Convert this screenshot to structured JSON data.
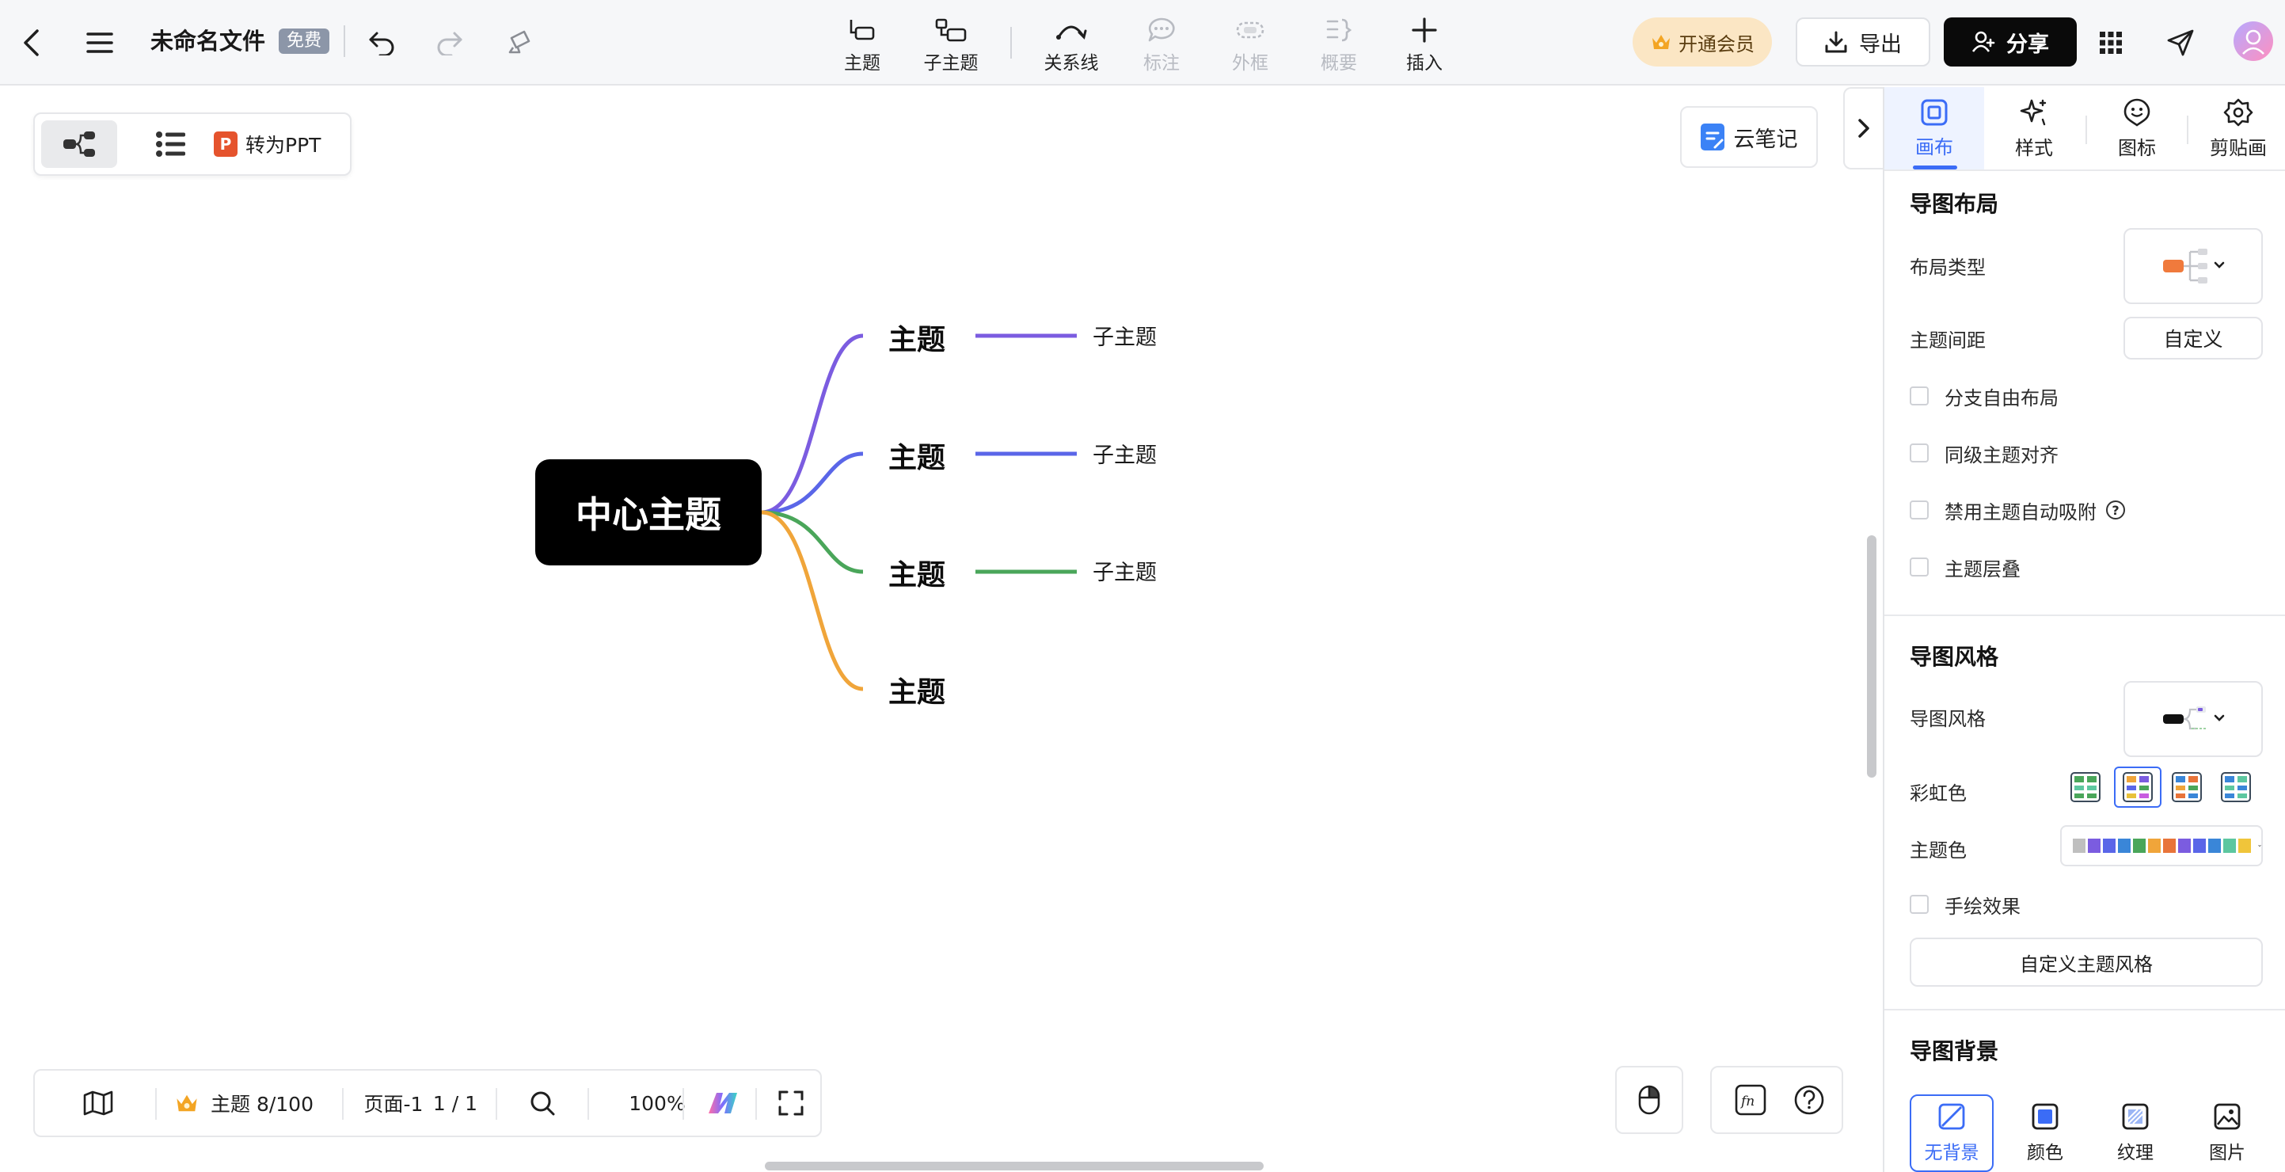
{
  "header": {
    "filename": "未命名文件",
    "badge": "免费",
    "tools": [
      {
        "label": "主题",
        "icon": "topic-icon",
        "enabled": true
      },
      {
        "label": "子主题",
        "icon": "subtopic-icon",
        "enabled": true
      },
      {
        "label": "关系线",
        "icon": "relation-line-icon",
        "enabled": true
      },
      {
        "label": "标注",
        "icon": "callout-icon",
        "enabled": false
      },
      {
        "label": "外框",
        "icon": "boundary-icon",
        "enabled": false
      },
      {
        "label": "概要",
        "icon": "summary-icon",
        "enabled": false
      },
      {
        "label": "插入",
        "icon": "plus-icon",
        "enabled": true
      }
    ],
    "vip_label": "开通会员",
    "export_label": "导出",
    "share_label": "分享"
  },
  "canvas": {
    "ppt_label": "转为PPT",
    "cloud_note_label": "云笔记",
    "center_topic": "中心主题",
    "topics": [
      {
        "label": "主题",
        "subtopic": "子主题",
        "color": "#7b5ce0"
      },
      {
        "label": "主题",
        "subtopic": "子主题",
        "color": "#5a66e8"
      },
      {
        "label": "主题",
        "subtopic": "子主题",
        "color": "#4aa65a"
      },
      {
        "label": "主题",
        "subtopic": "",
        "color": "#f0a53a"
      }
    ]
  },
  "bottom": {
    "topic_count": "主题 8/100",
    "page_label": "页面-1",
    "page_index": "1 / 1",
    "zoom": "100%"
  },
  "panel": {
    "tabs": [
      {
        "label": "画布",
        "icon": "canvas-icon",
        "active": true
      },
      {
        "label": "样式",
        "icon": "style-sparkle-icon",
        "active": false
      },
      {
        "label": "图标",
        "icon": "sticker-icon",
        "active": false
      },
      {
        "label": "剪贴画",
        "icon": "clipart-icon",
        "active": false
      }
    ],
    "layout": {
      "title": "导图布局",
      "layout_type_label": "布局类型",
      "spacing_label": "主题间距",
      "spacing_value": "自定义",
      "options": [
        "分支自由布局",
        "同级主题对齐",
        "禁用主题自动吸附",
        "主题层叠"
      ]
    },
    "style": {
      "title": "导图风格",
      "style_label": "导图风格",
      "rainbow_label": "彩虹色",
      "theme_color_label": "主题色",
      "theme_colors": [
        "#bfbfbf",
        "#7b5ce0",
        "#5a66e8",
        "#3a86d8",
        "#4aa65a",
        "#f0a53a",
        "#e8743a",
        "#7b5ce0",
        "#5a66e8",
        "#3a86d8",
        "#5dc7a0",
        "#f0c53a"
      ],
      "hand_drawn_label": "手绘效果",
      "custom_style_label": "自定义主题风格"
    },
    "background": {
      "title": "导图背景",
      "options": [
        {
          "label": "无背景",
          "icon": "no-background-icon",
          "active": true
        },
        {
          "label": "颜色",
          "icon": "color-fill-icon",
          "active": false
        },
        {
          "label": "纹理",
          "icon": "texture-icon",
          "active": false
        },
        {
          "label": "图片",
          "icon": "image-icon",
          "active": false
        }
      ]
    }
  }
}
